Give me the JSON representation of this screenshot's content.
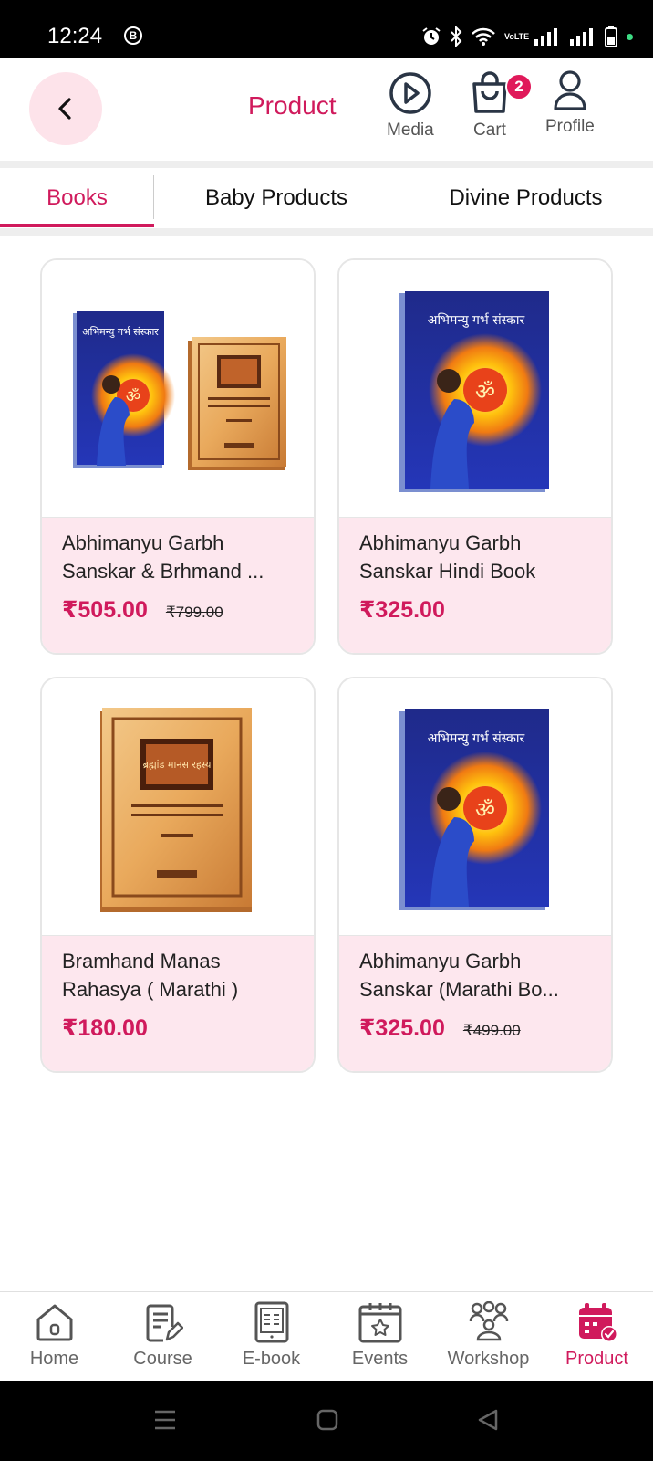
{
  "status_bar": {
    "time": "12:24",
    "b_icon": "B",
    "volte": "VoLTE",
    "right_icons": [
      "alarm-icon",
      "bluetooth-icon",
      "wifi-icon",
      "volte-icon",
      "signal-icon",
      "signal-icon",
      "battery-icon"
    ]
  },
  "header": {
    "title": "Product",
    "back_icon": "chevron-left-icon",
    "media_label": "Media",
    "cart_label": "Cart",
    "cart_count": "2",
    "profile_label": "Profile"
  },
  "tabs": [
    {
      "label": "Books",
      "active": true
    },
    {
      "label": "Baby Products",
      "active": false
    },
    {
      "label": "Divine Products",
      "active": false
    }
  ],
  "products": [
    {
      "name": "Abhimanyu Garbh Sanskar & Brhmand ...",
      "price": "₹505.00",
      "mrp": "₹799.00",
      "image": "book-bundle-image",
      "image_text": "अभिमन्यु गर्भ संस्कार"
    },
    {
      "name": "Abhimanyu Garbh Sanskar Hindi Book",
      "price": "₹325.00",
      "mrp": "",
      "image": "book-cover-image",
      "image_text": "अभिमन्यु गर्भ संस्कार"
    },
    {
      "name": "Bramhand Manas Rahasya ( Marathi )",
      "price": "₹180.00",
      "mrp": "",
      "image": "book-cover-image",
      "image_text": "ब्रह्मांड मानस रहस्य"
    },
    {
      "name": "Abhimanyu Garbh Sanskar (Marathi Bo...",
      "price": "₹325.00",
      "mrp": "₹499.00",
      "image": "book-cover-image",
      "image_text": "अभिमन्यु गर्भ संस्कार"
    }
  ],
  "bottom_nav": [
    {
      "label": "Home",
      "icon": "home-icon",
      "active": false
    },
    {
      "label": "Course",
      "icon": "course-icon",
      "active": false
    },
    {
      "label": "E-book",
      "icon": "ebook-icon",
      "active": false
    },
    {
      "label": "Events",
      "icon": "events-icon",
      "active": false
    },
    {
      "label": "Workshop",
      "icon": "workshop-icon",
      "active": false
    },
    {
      "label": "Product",
      "icon": "product-icon",
      "active": true
    }
  ],
  "colors": {
    "accent": "#d01a5c",
    "card_bg": "#fde7ee",
    "back_bg": "#fde3ea",
    "badge": "#e0195a"
  }
}
